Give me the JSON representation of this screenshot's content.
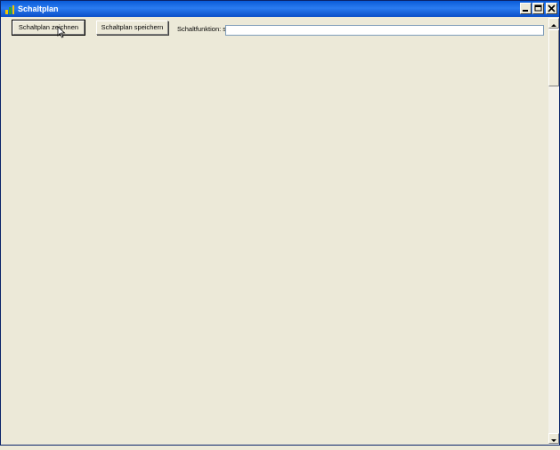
{
  "window": {
    "title": "Schaltplan"
  },
  "toolbar": {
    "draw_label": "Schaltplan zeichnen",
    "save_label": "Schaltplan speichern",
    "function_label": "Schaltfunktion: s=",
    "function_value": ""
  },
  "icons": {
    "app": "app-icon",
    "minimize": "minimize-icon",
    "maximize": "maximize-icon",
    "close": "close-icon",
    "scroll_up": "arrow-up-icon",
    "scroll_down": "arrow-down-icon",
    "cursor": "mouse-pointer-icon"
  },
  "colors": {
    "titlebar": "#0a5bd8",
    "background": "#ece9d8"
  }
}
